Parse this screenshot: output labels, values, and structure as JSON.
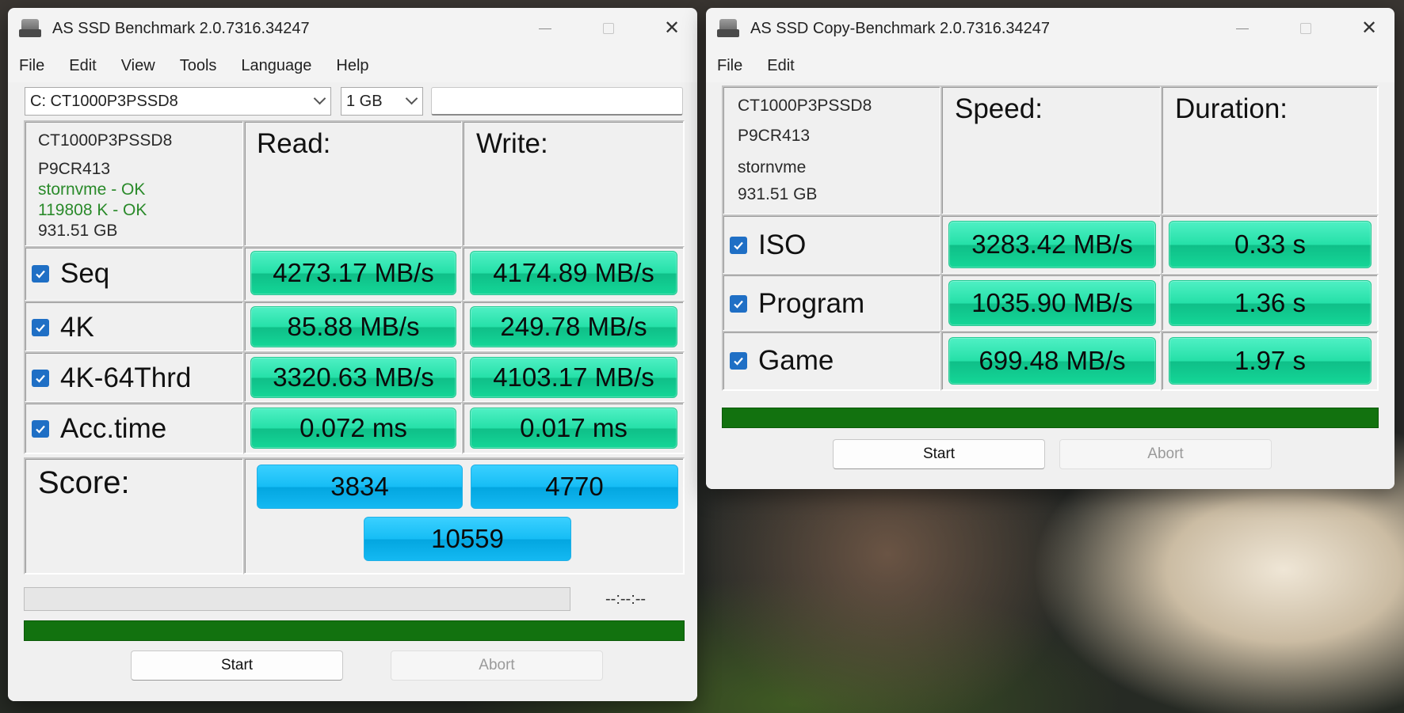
{
  "main": {
    "title": "AS SSD Benchmark 2.0.7316.34247",
    "menu": [
      "File",
      "Edit",
      "View",
      "Tools",
      "Language",
      "Help"
    ],
    "drive_select": "C: CT1000P3PSSD8",
    "size_select": "1 GB",
    "drive_info": [
      "CT1000P3PSSD8",
      "P9CR413",
      "stornvme - OK",
      "119808 K - OK",
      "931.51 GB"
    ],
    "read_header": "Read:",
    "write_header": "Write:",
    "rows": [
      {
        "label": "Seq",
        "read": "4273.17 MB/s",
        "write": "4174.89 MB/s"
      },
      {
        "label": "4K",
        "read": "85.88 MB/s",
        "write": "249.78 MB/s"
      },
      {
        "label": "4K-64Thrd",
        "read": "3320.63 MB/s",
        "write": "4103.17 MB/s"
      },
      {
        "label": "Acc.time",
        "read": "0.072 ms",
        "write": "0.017 ms"
      }
    ],
    "score_label": "Score:",
    "score_read": "3834",
    "score_write": "4770",
    "score_total": "10559",
    "eta": "--:--:--",
    "start_label": "Start",
    "abort_label": "Abort",
    "progress": 1.0
  },
  "copy": {
    "title": "AS SSD Copy-Benchmark 2.0.7316.34247",
    "menu": [
      "File",
      "Edit"
    ],
    "drive_info": [
      "CT1000P3PSSD8",
      "P9CR413",
      "stornvme",
      "931.51 GB"
    ],
    "speed_header": "Speed:",
    "duration_header": "Duration:",
    "rows": [
      {
        "label": "ISO",
        "speed": "3283.42 MB/s",
        "duration": "0.33 s"
      },
      {
        "label": "Program",
        "speed": "1035.90 MB/s",
        "duration": "1.36 s"
      },
      {
        "label": "Game",
        "speed": "699.48 MB/s",
        "duration": "1.97 s"
      }
    ],
    "start_label": "Start",
    "abort_label": "Abort",
    "progress": 1.0
  },
  "colors": {
    "result_bar": "#25e0a8",
    "score_bar": "#16bdf5",
    "progress_fill": "#12720f",
    "checkbox": "#1f6fc5"
  }
}
